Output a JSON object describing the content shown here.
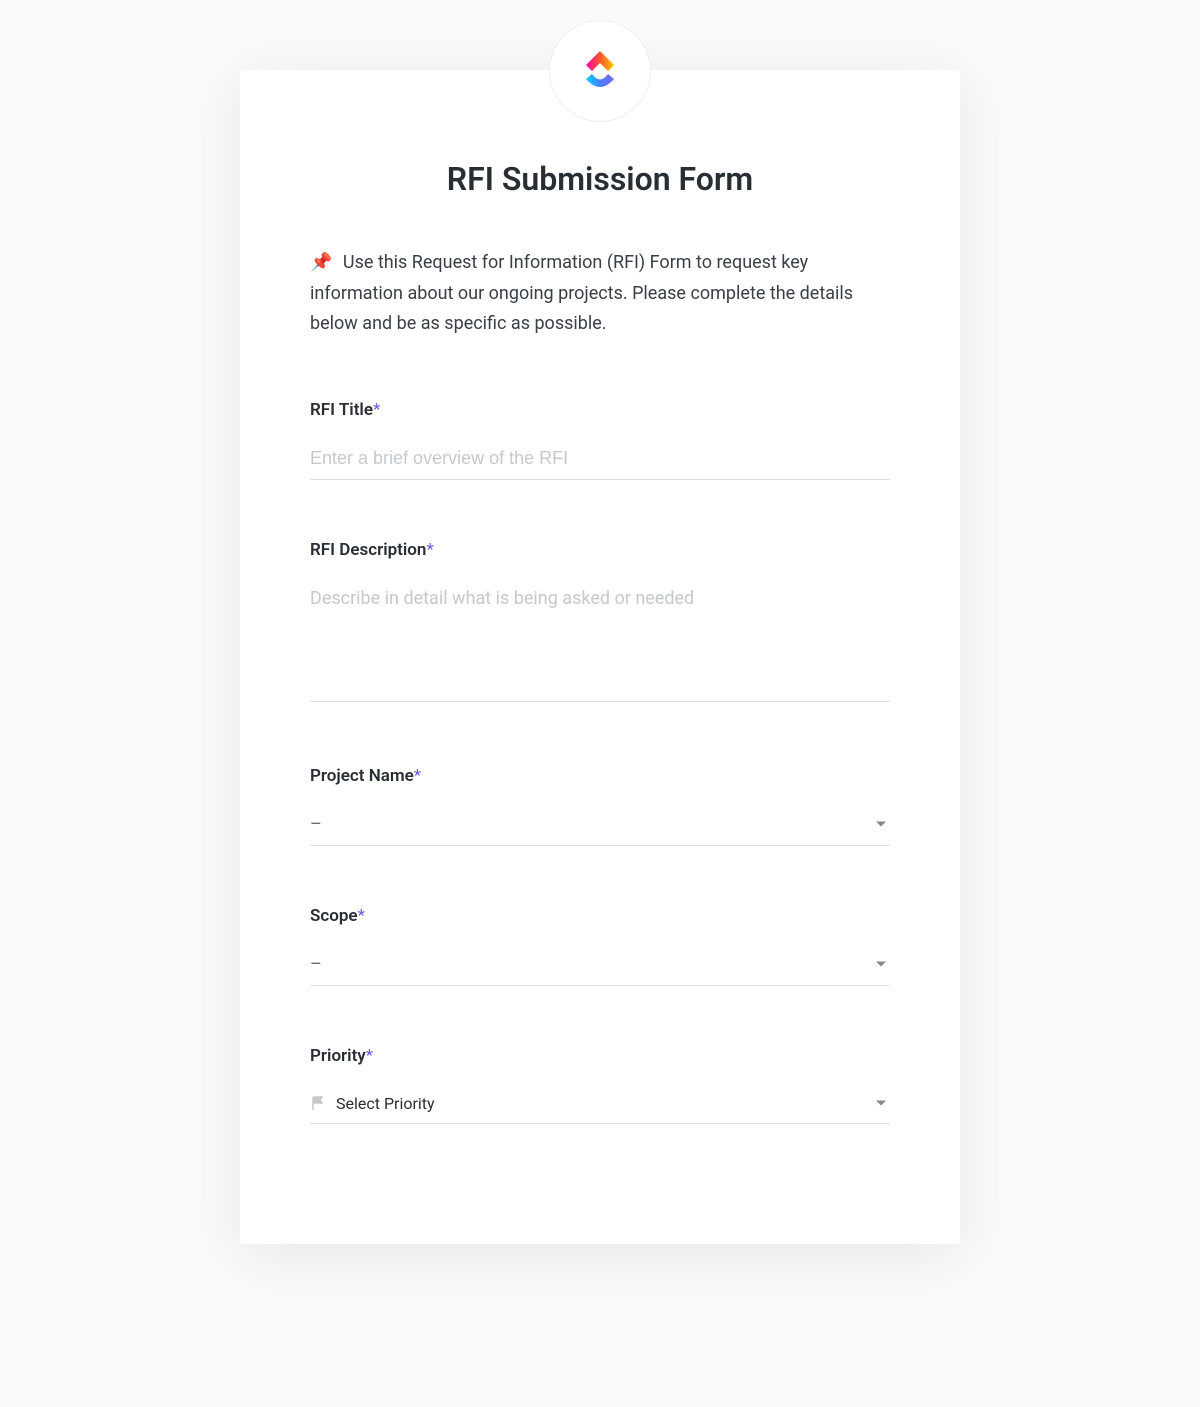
{
  "form": {
    "title": "RFI Submission Form",
    "description_emoji": "📌",
    "description": "Use this Request for Information (RFI) Form to request key information about our ongoing projects. Please complete the details below and be as specific as possible.",
    "fields": {
      "rfi_title": {
        "label": "RFI Title",
        "placeholder": "Enter a brief overview of the RFI"
      },
      "rfi_description": {
        "label": "RFI Description",
        "placeholder": "Describe in detail what is being asked or needed"
      },
      "project_name": {
        "label": "Project Name",
        "value": "–"
      },
      "scope": {
        "label": "Scope",
        "value": "–"
      },
      "priority": {
        "label": "Priority",
        "placeholder": "Select Priority"
      }
    },
    "required_marker": "*"
  }
}
